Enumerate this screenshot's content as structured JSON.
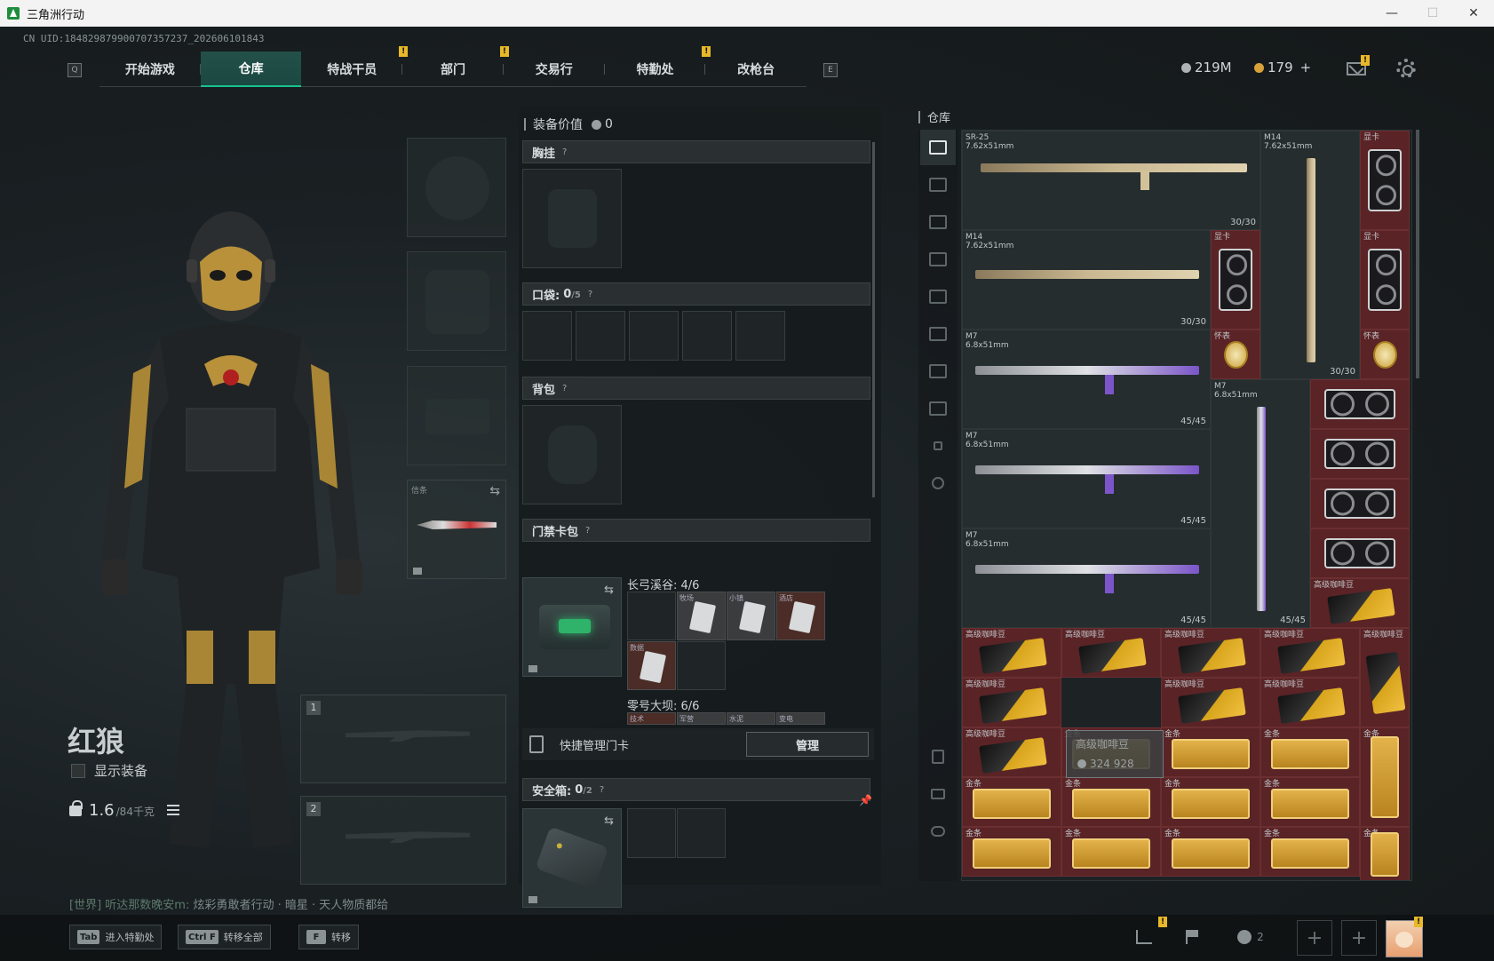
{
  "window": {
    "title": "三角洲行动",
    "minimize": "—",
    "maximize": "☐",
    "close": "✕"
  },
  "uid": "CN UID:184829879900707357237_202606101843",
  "nav": {
    "left_key": "Q",
    "right_key": "E",
    "tabs": [
      {
        "label": "开始游戏",
        "badge": ""
      },
      {
        "label": "仓库",
        "badge": ""
      },
      {
        "label": "特战干员",
        "badge": "!"
      },
      {
        "label": "部门",
        "badge": "!"
      },
      {
        "label": "交易行",
        "badge": ""
      },
      {
        "label": "特勤处",
        "badge": "!"
      },
      {
        "label": "改枪台",
        "badge": ""
      }
    ]
  },
  "currency": {
    "silver": "219M",
    "gold": "179",
    "plus": "+",
    "mail_badge": "!"
  },
  "operator": {
    "name": "红狼",
    "show_equipment": "显示装备",
    "weight": "1.6",
    "weight_max": "/84千克",
    "chat_channel": "[世界] 听达那数晚安m:",
    "chat_text": "炫彩勇敢者行动 · 暗星 · 天人物质都给"
  },
  "equipment": {
    "knife_label": "信条",
    "weapon_slots": [
      "1",
      "2"
    ]
  },
  "middle": {
    "equip_value_label": "装备价值",
    "equip_value": "0",
    "chest_rig": "胸挂",
    "pocket_label": "口袋:",
    "pocket_count": "0",
    "pocket_max": "/5",
    "backpack": "背包",
    "keycard_pack": "门禁卡包",
    "q": "?",
    "keycard_groups": [
      {
        "title": "长弓溪谷: 4/6",
        "cards": [
          "牧场",
          "小镇",
          "酒店",
          "数据"
        ]
      },
      {
        "title": "零号大坝: 6/6",
        "cards": [
          "技术",
          "军营",
          "水泥",
          "变电"
        ]
      }
    ],
    "quick_manage": "快捷管理门卡",
    "manage": "管理",
    "safe_label": "安全箱:",
    "safe_count": "0",
    "safe_max": "/2"
  },
  "storage": {
    "title": "仓库",
    "guns": [
      {
        "name": "SR-25\n7.62x51mm",
        "ammo": "30/30"
      },
      {
        "name": "M14\n7.62x51mm",
        "ammo": "30/30"
      },
      {
        "name": "M14\n7.62x51mm",
        "ammo": "30/30"
      },
      {
        "name": "M7\n6.8x51mm",
        "ammo": "45/45"
      },
      {
        "name": "M7\n6.8x51mm",
        "ammo": "45/45"
      },
      {
        "name": "M7\n6.8x51mm",
        "ammo": "45/45"
      },
      {
        "name": "M7\n6.8x51mm",
        "ammo": "45/45"
      }
    ],
    "gpu_label": "显卡",
    "watch_label": "怀表",
    "coffee_label": "高级咖啡豆",
    "gold_label": "金条",
    "tooltip_name": "高级咖啡豆",
    "tooltip_price": "324 928"
  },
  "bottom": {
    "hints": [
      {
        "key": "Tab",
        "label": "进入特勤处"
      },
      {
        "key": "Ctrl F",
        "label": "转移全部"
      },
      {
        "key": "F",
        "label": "转移"
      }
    ],
    "friends_count": "2",
    "plus": "+",
    "badge": "!"
  }
}
